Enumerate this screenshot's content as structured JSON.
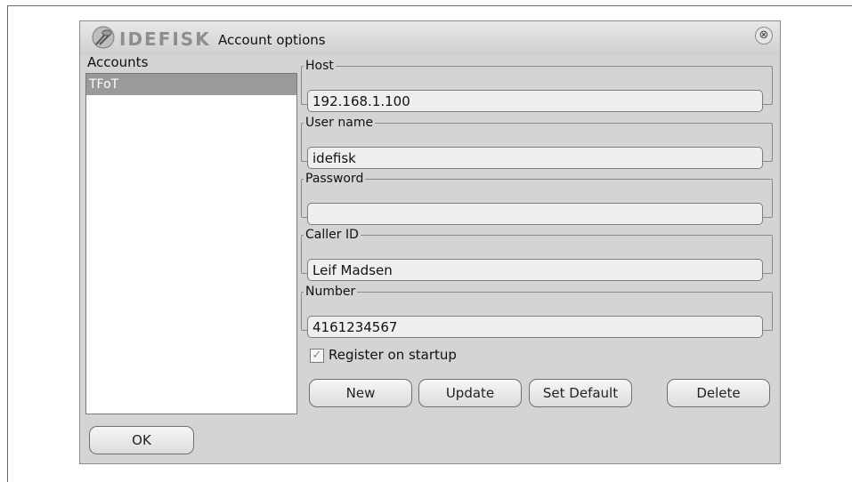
{
  "window": {
    "logo_text": "IDEFISK",
    "title": "Account options",
    "close_symbol": "⊗"
  },
  "accounts": {
    "label": "Accounts",
    "items": [
      {
        "name": "TFoT",
        "selected": true
      }
    ]
  },
  "fields": {
    "host": {
      "legend": "Host",
      "value": "192.168.1.100"
    },
    "username": {
      "legend": "User name",
      "value": "idefisk"
    },
    "password": {
      "legend": "Password",
      "value": ""
    },
    "caller_id": {
      "legend": "Caller ID",
      "value": "Leif Madsen"
    },
    "number": {
      "legend": "Number",
      "value": "4161234567"
    }
  },
  "register": {
    "label": "Register on startup",
    "checked": true,
    "check_mark": "✓"
  },
  "buttons": {
    "new": "New",
    "update": "Update",
    "set_default": "Set Default",
    "delete": "Delete",
    "ok": "OK"
  },
  "colors": {
    "dialog_bg": "#d4d4d4",
    "selection_bg": "#9a9a9a",
    "logo": "#8e8e8e"
  },
  "icons": {
    "logo": "idefisk-logo-icon",
    "close": "close-icon",
    "checkbox": "checkbox-check-icon"
  }
}
